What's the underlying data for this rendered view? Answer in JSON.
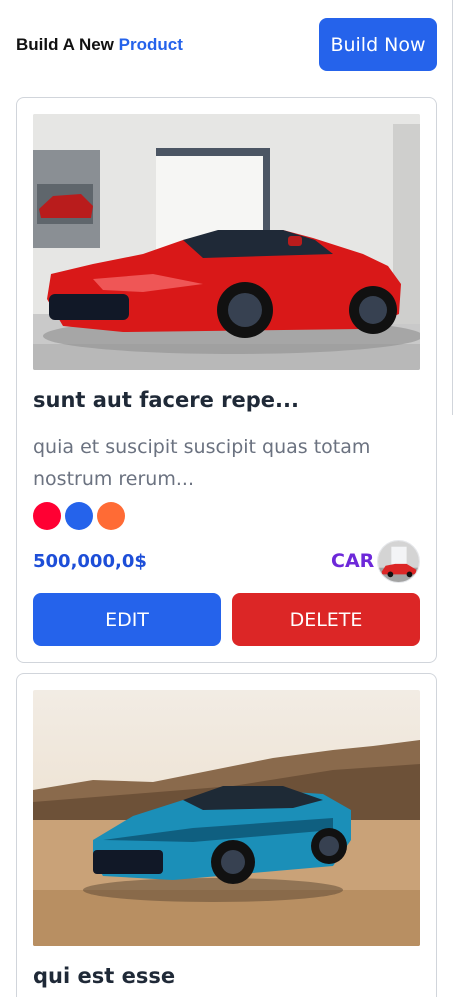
{
  "header": {
    "brand_prefix": "Build A New",
    "brand_accent": "Product",
    "build_button": "Build Now"
  },
  "colors": {
    "primary": "#2563eb",
    "danger": "#dc2626",
    "category": "#6d28d9"
  },
  "products": [
    {
      "image": "red-sports-car-photo",
      "title": "sunt aut facere repe...",
      "description": "quia et suscipit suscipit quas totam nostrum rerum...",
      "swatches": [
        "#ff0033",
        "#2563eb",
        "#ff6b35"
      ],
      "price": "500,000,0$",
      "category": "CAR",
      "avatar": "red-sports-car-thumbnail",
      "edit_label": "EDIT",
      "delete_label": "DELETE"
    },
    {
      "image": "blue-muscle-car-photo",
      "title": "qui est esse"
    }
  ]
}
